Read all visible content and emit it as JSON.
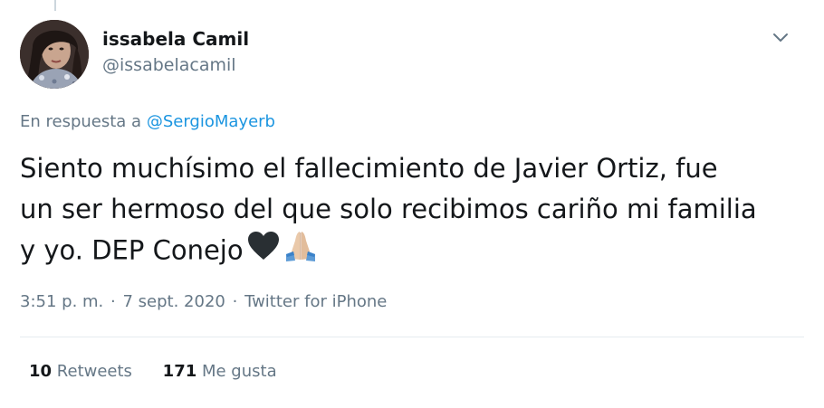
{
  "author": {
    "display_name": "issabela Camil",
    "handle": "@issabelacamil"
  },
  "reply": {
    "prefix": "En respuesta a",
    "mention": "@SergioMayerb"
  },
  "tweet": {
    "lines": [
      "Siento muchísimo el fallecimiento  de Javier Ortiz, fue",
      "un ser hermoso del que solo recibimos cariño mi familia",
      "y yo. DEP Conejo"
    ],
    "emoji": [
      "black-heart-icon",
      "folded-hands-icon"
    ]
  },
  "meta": {
    "time": "3:51 p. m.",
    "separator": "·",
    "date": "7 sept. 2020",
    "source": "Twitter for iPhone"
  },
  "stats": {
    "retweets_count": "10",
    "retweets_label": "Retweets",
    "likes_count": "171",
    "likes_label": "Me gusta"
  },
  "colors": {
    "text": "#14171a",
    "secondary": "#657786",
    "link": "#1b95e0",
    "divider": "#e6ecf0"
  }
}
